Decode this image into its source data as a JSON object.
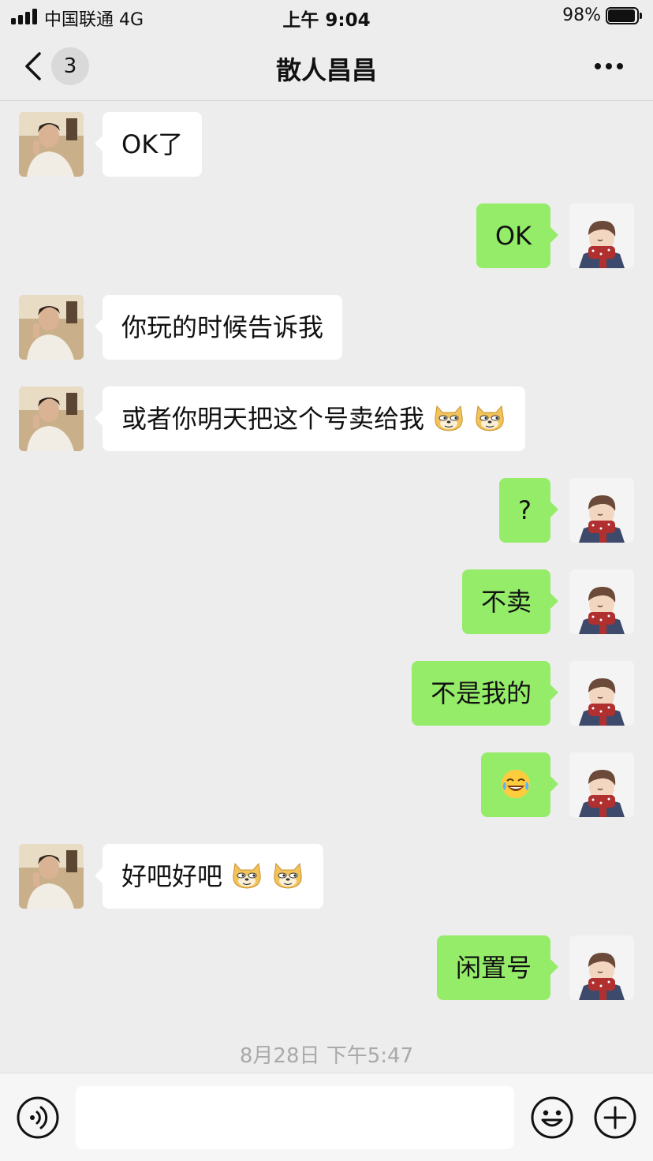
{
  "status_bar": {
    "carrier": "中国联通   4G",
    "time": "上午 9:04",
    "battery": "98%"
  },
  "nav": {
    "unread_count": "3",
    "title": "散人昌昌"
  },
  "messages": [
    {
      "side": "in",
      "text": "OK了",
      "emoji": []
    },
    {
      "side": "out",
      "text": "OK",
      "emoji": []
    },
    {
      "side": "in",
      "text": "你玩的时候告诉我",
      "emoji": []
    },
    {
      "side": "in",
      "text": "或者你明天把这个号卖给我",
      "emoji": [
        "doge-icon",
        "doge-icon"
      ]
    },
    {
      "side": "out",
      "text": "?",
      "emoji": []
    },
    {
      "side": "out",
      "text": "不卖",
      "emoji": []
    },
    {
      "side": "out",
      "text": "不是我的",
      "emoji": []
    },
    {
      "side": "out",
      "text": "",
      "emoji": [
        "laugh-cry-icon"
      ]
    },
    {
      "side": "in",
      "text": "好吧好吧",
      "emoji": [
        "doge-icon",
        "doge-icon"
      ]
    },
    {
      "side": "out",
      "text": "闲置号",
      "emoji": []
    }
  ],
  "timestamp": "8月28日 下午5:47",
  "input": {
    "value": "",
    "placeholder": ""
  },
  "colors": {
    "background": "#ededed",
    "incoming_bubble": "#ffffff",
    "outgoing_bubble": "#95ec69",
    "timestamp_text": "#a9a9a9"
  }
}
